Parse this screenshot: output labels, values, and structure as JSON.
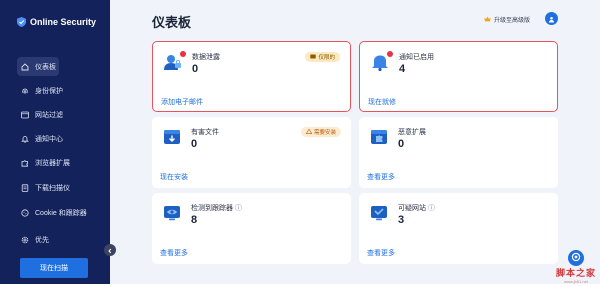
{
  "app": {
    "name": "Online Security"
  },
  "sidebar": {
    "items": [
      {
        "label": "仪表板",
        "icon": "home-icon",
        "active": true
      },
      {
        "label": "身份保护",
        "icon": "fingerprint-icon"
      },
      {
        "label": "网站过滤",
        "icon": "browser-shield-icon"
      },
      {
        "label": "通知中心",
        "icon": "bell-icon"
      },
      {
        "label": "浏览器扩展",
        "icon": "puzzle-icon"
      },
      {
        "label": "下载扫描仪",
        "icon": "download-scan-icon"
      },
      {
        "label": "Cookie 和跟踪器",
        "icon": "cookie-icon"
      },
      {
        "label": "优先",
        "icon": "settings-gear-icon"
      }
    ],
    "scan_button": "现在扫描"
  },
  "header": {
    "title": "仪表板",
    "upgrade_label": "升级至高级版"
  },
  "cards": [
    {
      "title": "数据泄露",
      "value": "0",
      "link": "添加电子邮件",
      "tag": "仅限的",
      "alert": true,
      "dot": true
    },
    {
      "title": "通知已启用",
      "value": "4",
      "link": "现在就修",
      "alert": true,
      "dot": true
    },
    {
      "title": "有害文件",
      "value": "0",
      "link": "现在安装",
      "tag": "需要安装"
    },
    {
      "title": "恶意扩展",
      "value": "0",
      "link": "查看更多"
    },
    {
      "title": "检测到跟踪器",
      "value": "8",
      "link": "查看更多",
      "info": "ⓘ"
    },
    {
      "title": "可疑网站",
      "value": "3",
      "link": "查看更多",
      "info": "ⓘ"
    }
  ],
  "watermark": {
    "main": "脚本之家",
    "sub": "www.jb51.net"
  },
  "colors": {
    "sidebar": "#14225b",
    "accent": "#1f6fe0",
    "alert_border": "#e6555e",
    "background": "#f0f3f9"
  }
}
